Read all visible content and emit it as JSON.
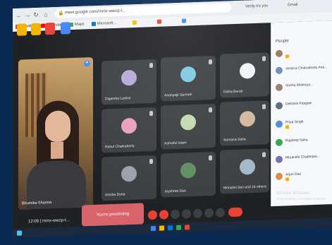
{
  "browser": {
    "url": "meet.google.com/mmx-wwzp-t...",
    "bookmarks": [
      "Gmail",
      "YouTube",
      "Maps",
      "Microsoft...",
      "",
      "",
      ""
    ],
    "right_labels": [
      "Verify it's you",
      "Gmail"
    ]
  },
  "app_buttons": [
    {
      "icon": "yellow-app-icon",
      "color": "#f4b400"
    },
    {
      "icon": "yellow-app-icon",
      "color": "#f4b400"
    },
    {
      "icon": "red-app-icon",
      "color": "#e94235"
    },
    {
      "icon": "blue-app-icon",
      "color": "#4285f4"
    }
  ],
  "self_tile": {
    "name": "Bhumika Sharma"
  },
  "tiles": [
    {
      "name": "Digamba Laskar",
      "avatar_color": "#b8a9d9"
    },
    {
      "name": "Ananyajit Sarmah",
      "avatar_color": "#7ec8e3"
    },
    {
      "name": "Disha Borah",
      "avatar_color": "#f1f3f4"
    },
    {
      "name": "Rahul Chakraborty",
      "avatar_color": "#e8a0bf"
    },
    {
      "name": "Ashraful Islam",
      "avatar_color": "#c3d9b0"
    },
    {
      "name": "Sumana Saha",
      "avatar_color": "#d4b8a0"
    },
    {
      "name": "Anisha Dutta",
      "avatar_color": "#9aa3ad"
    },
    {
      "name": "Joyshree Das",
      "avatar_color": "#5f8f5f"
    },
    {
      "name": "Mrinalini Sen and 16 others",
      "avatar_color": "#a3b8c9"
    }
  ],
  "bottom": {
    "time": "12:09 | mmx-wwzp-t...",
    "present_label": "You're presenting"
  },
  "people_panel": {
    "title": "People",
    "members": [
      {
        "name": "",
        "color": "#9c7b5e"
      },
      {
        "name": "Jessica Chakraborty Ans...",
        "color": "#6d8fb0"
      },
      {
        "name": "Sneha Moitreya...",
        "color": "#a07a6a"
      },
      {
        "name": "Debasis Pasgaw",
        "color": "#5b6d7f"
      },
      {
        "name": "Priya Singh",
        "color": "#4a90d9"
      },
      {
        "name": "Rajdeep Saha",
        "color": "#34a853"
      },
      {
        "name": "Moutushi Chatterjee...",
        "color": "#7a6fb0"
      },
      {
        "name": "Arjun Das",
        "color": "#d98f4a"
      }
    ]
  },
  "watermark": {
    "line1": "Activate Windows",
    "line2": "Go to Settings to activate Windows."
  }
}
